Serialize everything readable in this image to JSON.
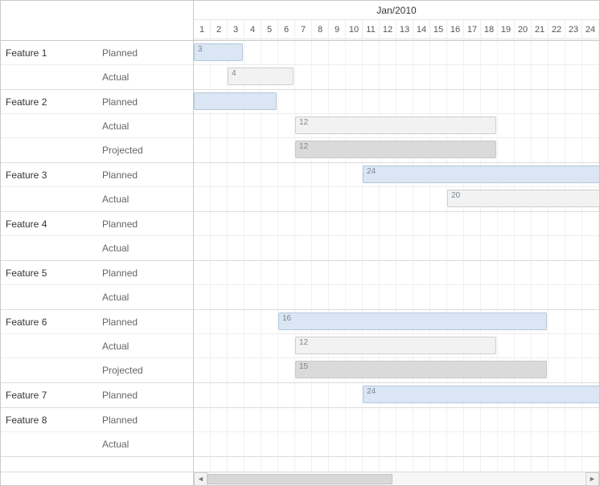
{
  "header": {
    "month_label": "Jan/2010",
    "days": [
      "1",
      "2",
      "3",
      "4",
      "5",
      "6",
      "7",
      "8",
      "9",
      "10",
      "11",
      "12",
      "13",
      "14",
      "15",
      "16",
      "17",
      "18",
      "19",
      "20",
      "21",
      "22",
      "23",
      "24"
    ]
  },
  "features": [
    {
      "name": "Feature 1",
      "tracks": [
        {
          "label": "Planned",
          "bar": {
            "start": 1,
            "span": 3,
            "text": "3",
            "kind": "planned"
          }
        },
        {
          "label": "Actual",
          "bar": {
            "start": 3,
            "span": 4,
            "text": "4",
            "kind": "actual"
          }
        }
      ]
    },
    {
      "name": "Feature 2",
      "tracks": [
        {
          "label": "Planned",
          "bar": {
            "start": 1,
            "span": 5,
            "text": "",
            "kind": "planned"
          }
        },
        {
          "label": "Actual",
          "bar": {
            "start": 7,
            "span": 12,
            "text": "12",
            "kind": "actual"
          }
        },
        {
          "label": "Projected",
          "bar": {
            "start": 7,
            "span": 12,
            "text": "12",
            "kind": "projected"
          }
        }
      ]
    },
    {
      "name": "Feature 3",
      "tracks": [
        {
          "label": "Planned",
          "bar": {
            "start": 11,
            "span": 24,
            "text": "24",
            "kind": "planned"
          }
        },
        {
          "label": "Actual",
          "bar": {
            "start": 16,
            "span": 20,
            "text": "20",
            "kind": "actual"
          }
        }
      ]
    },
    {
      "name": "Feature 4",
      "tracks": [
        {
          "label": "Planned",
          "bar": null
        },
        {
          "label": "Actual",
          "bar": null
        }
      ]
    },
    {
      "name": "Feature 5",
      "tracks": [
        {
          "label": "Planned",
          "bar": null
        },
        {
          "label": "Actual",
          "bar": null
        }
      ]
    },
    {
      "name": "Feature 6",
      "tracks": [
        {
          "label": "Planned",
          "bar": {
            "start": 6,
            "span": 16,
            "text": "16",
            "kind": "planned"
          }
        },
        {
          "label": "Actual",
          "bar": {
            "start": 7,
            "span": 12,
            "text": "12",
            "kind": "actual"
          }
        },
        {
          "label": "Projected",
          "bar": {
            "start": 7,
            "span": 15,
            "text": "15",
            "kind": "projected"
          }
        }
      ]
    },
    {
      "name": "Feature 7",
      "tracks": [
        {
          "label": "Planned",
          "bar": {
            "start": 11,
            "span": 24,
            "text": "24",
            "kind": "planned"
          }
        }
      ]
    },
    {
      "name": "Feature 8",
      "tracks": [
        {
          "label": "Planned",
          "bar": null
        },
        {
          "label": "Actual",
          "bar": null
        }
      ]
    }
  ],
  "chart_data": {
    "type": "bar",
    "title": "",
    "xlabel": "Jan/2010",
    "ylabel": "",
    "x_range": [
      1,
      24
    ],
    "series": [
      {
        "feature": "Feature 1",
        "track": "Planned",
        "start_day": 1,
        "duration_days": 3
      },
      {
        "feature": "Feature 1",
        "track": "Actual",
        "start_day": 3,
        "duration_days": 4
      },
      {
        "feature": "Feature 2",
        "track": "Planned",
        "start_day": 1,
        "duration_days": 5
      },
      {
        "feature": "Feature 2",
        "track": "Actual",
        "start_day": 7,
        "duration_days": 12
      },
      {
        "feature": "Feature 2",
        "track": "Projected",
        "start_day": 7,
        "duration_days": 12
      },
      {
        "feature": "Feature 3",
        "track": "Planned",
        "start_day": 11,
        "duration_days": 24
      },
      {
        "feature": "Feature 3",
        "track": "Actual",
        "start_day": 16,
        "duration_days": 20
      },
      {
        "feature": "Feature 6",
        "track": "Planned",
        "start_day": 6,
        "duration_days": 16
      },
      {
        "feature": "Feature 6",
        "track": "Actual",
        "start_day": 7,
        "duration_days": 12
      },
      {
        "feature": "Feature 6",
        "track": "Projected",
        "start_day": 7,
        "duration_days": 15
      },
      {
        "feature": "Feature 7",
        "track": "Planned",
        "start_day": 11,
        "duration_days": 24
      }
    ]
  },
  "scrollbar": {
    "left_icon": "◄",
    "right_icon": "►"
  }
}
